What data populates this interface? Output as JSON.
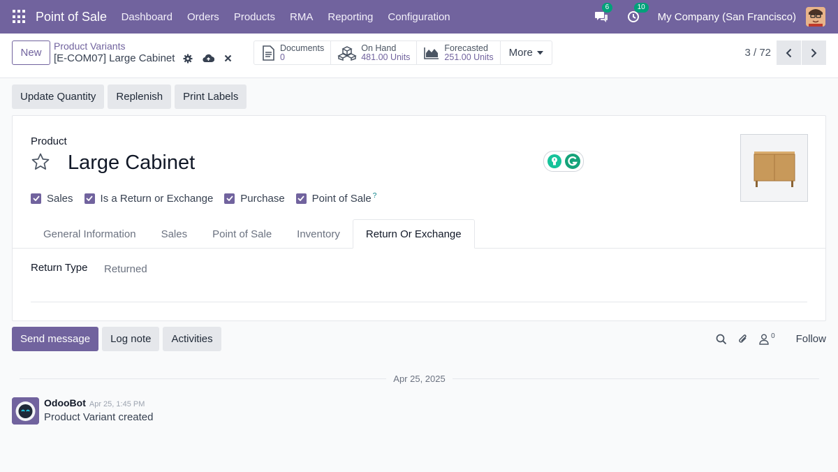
{
  "navbar": {
    "app_title": "Point of Sale",
    "menu": [
      "Dashboard",
      "Orders",
      "Products",
      "RMA",
      "Reporting",
      "Configuration"
    ],
    "messages_count": "6",
    "activities_count": "10",
    "company": "My Company (San Francisco)"
  },
  "control": {
    "new_label": "New",
    "breadcrumb_parent": "Product Variants",
    "breadcrumb_current": "[E-COM07] Large Cabinet",
    "stats": [
      {
        "label": "Documents",
        "value": "0"
      },
      {
        "label": "On Hand",
        "value": "481.00 Units"
      },
      {
        "label": "Forecasted",
        "value": "251.00 Units"
      }
    ],
    "more_label": "More",
    "pager_value": "3 / 72"
  },
  "actions": [
    "Update Quantity",
    "Replenish",
    "Print Labels"
  ],
  "form": {
    "product_label": "Product",
    "product_name": "Large Cabinet",
    "checkboxes": [
      "Sales",
      "Is a Return or Exchange",
      "Purchase",
      "Point of Sale"
    ],
    "help_mark": "?",
    "tabs": [
      "General Information",
      "Sales",
      "Point of Sale",
      "Inventory",
      "Return Or Exchange"
    ],
    "active_tab": "Return Or Exchange",
    "return_type_label": "Return Type",
    "return_type_value": "Returned"
  },
  "chatter": {
    "send_message": "Send message",
    "log_note": "Log note",
    "activities": "Activities",
    "followers_count": "0",
    "follow_label": "Follow",
    "date_separator": "Apr 25, 2025",
    "messages": [
      {
        "author": "OdooBot",
        "time": "Apr 25, 1:45 PM",
        "body": "Product Variant created"
      }
    ]
  },
  "colors": {
    "brand": "#71639e",
    "badge": "#00a17a",
    "help": "#017e84"
  },
  "icons": [
    "apps-icon",
    "chat-icon",
    "activity-clock-icon",
    "gear-icon",
    "cloud-upload-icon",
    "close-icon",
    "document-icon",
    "cubes-icon",
    "area-chart-icon",
    "caret-down-icon",
    "chevron-left-icon",
    "chevron-right-icon",
    "star-icon",
    "search-icon",
    "paperclip-icon",
    "user-icon"
  ]
}
